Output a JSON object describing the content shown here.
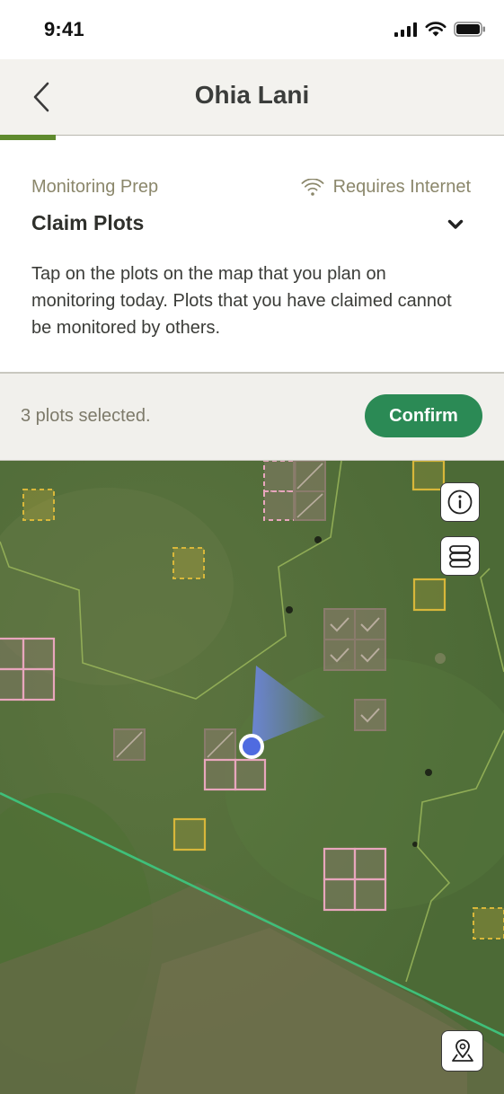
{
  "status_bar": {
    "time": "9:41",
    "icons": [
      "cellular-signal-icon",
      "wifi-icon",
      "battery-icon"
    ]
  },
  "header": {
    "title": "Ohia Lani",
    "back_icon": "chevron-left-icon"
  },
  "progress": {
    "fraction": 0.11,
    "color": "#5f8a2e"
  },
  "monitoring": {
    "section_label": "Monitoring Prep",
    "internet_label": "Requires Internet",
    "internet_icon": "wifi-icon",
    "step_title": "Claim Plots",
    "expand_icon": "chevron-down-icon",
    "instructions": "Tap on the plots on the map that you plan on monitoring today. Plots that you have claimed cannot be monitored by others."
  },
  "selection": {
    "text": "3 plots selected.",
    "confirm_label": "Confirm",
    "accent": "#2b8a55"
  },
  "map": {
    "controls": [
      "info-icon",
      "layers-icon",
      "location-pin-icon"
    ],
    "legend_colors": {
      "selected": "#e8a6bd",
      "available": "#d8b73a",
      "claimed": "#8a7b6c",
      "boundary": "#9ab65a",
      "line": "#3fc07a",
      "user_heading": "#6e88ee"
    }
  }
}
